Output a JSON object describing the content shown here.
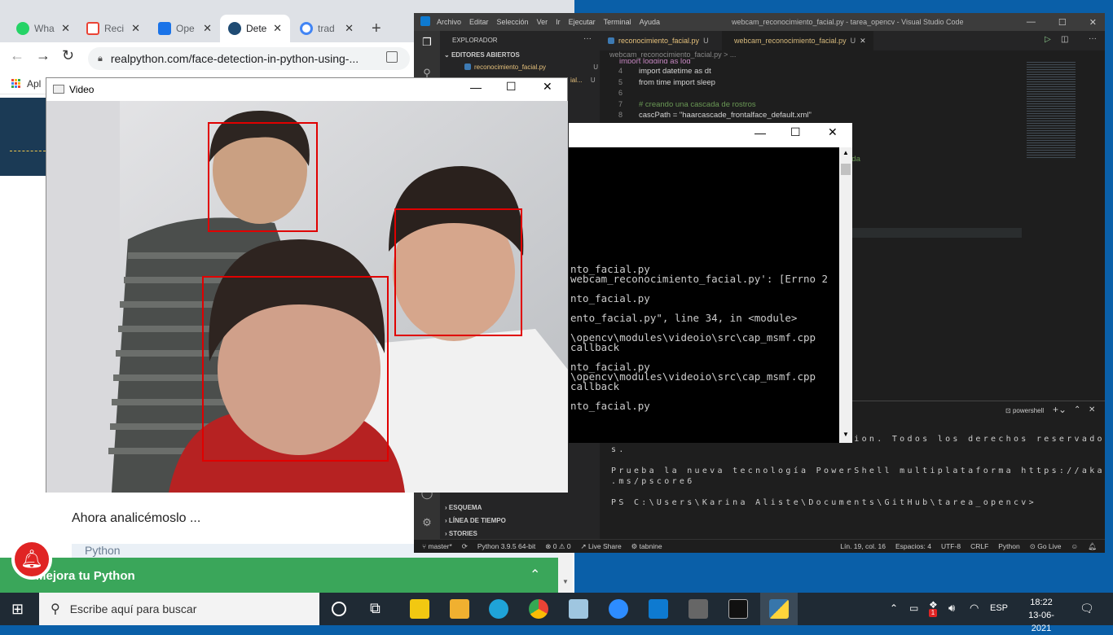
{
  "browser": {
    "tabs": [
      {
        "label": "Wha",
        "icon": "whatsapp-icon",
        "color": "#25d366"
      },
      {
        "label": "Reci",
        "icon": "gmail-icon",
        "color": "#ea4335"
      },
      {
        "label": "Ope",
        "icon": "opencv-icon",
        "color": "#1a73e8"
      },
      {
        "label": "Dete",
        "icon": "realpython-icon",
        "color": "#1f4b73"
      },
      {
        "label": "trad",
        "icon": "google-icon",
        "color": "#4285f4"
      }
    ],
    "url": "realpython.com/face-detection-in-python-using-...",
    "bookmarks_label": "Apl",
    "body_text": "Ahora analicémoslo ...",
    "code_tab": "Python",
    "promo_text": "Mejora tu Python"
  },
  "video_window": {
    "title": "Video"
  },
  "vscode": {
    "menu": [
      "Archivo",
      "Editar",
      "Selección",
      "Ver",
      "Ir",
      "Ejecutar",
      "Terminal",
      "Ayuda"
    ],
    "window_title": "webcam_reconocimiento_facial.py - tarea_opencv - Visual Studio Code",
    "explorer_title": "EXPLORADOR",
    "open_editors": "EDITORES ABIERTOS",
    "open_files": [
      "reconocimiento_facial.py",
      "webcam_reconocimiento_facial.py"
    ],
    "tabs": [
      "reconocimiento_facial.py",
      "webcam_reconocimiento_facial.py"
    ],
    "breadcrumb": "webcam_reconocimiento_facial.py > ...",
    "code_lines": [
      {
        "n": "4",
        "text": "import datetime as dt"
      },
      {
        "n": "5",
        "text": "from time import sleep"
      },
      {
        "n": "6",
        "text": ""
      },
      {
        "n": "7",
        "text": "# creando una cascada de rostros"
      },
      {
        "n": "8",
        "text": "cascPath = \"haarcascade_frontalface_default.xml\""
      }
    ],
    "code_partial": "import logging as log",
    "hidden_snippet": "ada",
    "sidebar_sections": [
      "ESQUEMA",
      "LÍNEA DE TIEMPO",
      "STORIES"
    ],
    "terminal_label": "powershell",
    "terminal_lines": [
      "Copyright (C) Microsoft Corporation. Todos los derechos reservado",
      "s.",
      "",
      "Prueba la nueva tecnología PowerShell multiplataforma https://aka",
      ".ms/pscore6",
      "",
      "PS C:\\Users\\Karina Aliste\\Documents\\GitHub\\tarea_opencv>"
    ],
    "status": {
      "branch": "master*",
      "python": "Python 3.9.5 64-bit",
      "errors": "0",
      "warnings": "0",
      "liveshare": "Live Share",
      "tabnine": "tabnine",
      "position": "Lín. 19, col. 16",
      "spaces": "Espacios: 4",
      "encoding": "UTF-8",
      "eol": "CRLF",
      "language": "Python",
      "golive": "Go Live"
    }
  },
  "console_window": {
    "lines": [
      "nto_facial.py",
      "webcam_reconocimiento_facial.py': [Errno 2",
      "",
      "nto_facial.py",
      "",
      "ento_facial.py\", line 34, in <module>",
      "",
      "\\opencv\\modules\\videoio\\src\\cap_msmf.cpp",
      "callback",
      "",
      "nto_facial.py",
      "\\opencv\\modules\\videoio\\src\\cap_msmf.cpp",
      "callback",
      "",
      "nto_facial.py"
    ]
  },
  "taskbar": {
    "search_placeholder": "Escribe aquí para buscar",
    "language": "ESP",
    "time": "18:22",
    "date": "13-06-2021",
    "notification_count": "1"
  }
}
